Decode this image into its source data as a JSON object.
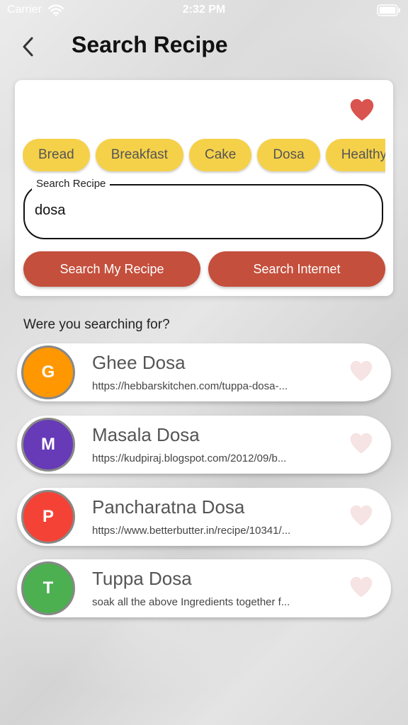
{
  "status_bar": {
    "carrier": "Carrier",
    "time": "2:32 PM"
  },
  "header": {
    "title": "Search Recipe",
    "back_icon": "chevron-left-icon"
  },
  "filter": {
    "favorite_icon": "heart-icon",
    "favorite_color": "#d9534f"
  },
  "categories": [
    "Bread",
    "Breakfast",
    "Cake",
    "Dosa",
    "Healthy"
  ],
  "search": {
    "label": "Search Recipe",
    "value": "dosa"
  },
  "buttons": {
    "search_my_recipe": "Search My Recipe",
    "search_internet": "Search Internet"
  },
  "colors": {
    "chip": "#f5d14a",
    "action_button": "#c44f3c",
    "unfavorited_heart": "#f6e3e3"
  },
  "suggestions": {
    "heading": "Were you searching for?",
    "items": [
      {
        "initial": "G",
        "title": "Ghee Dosa",
        "subtitle": "https://hebbarskitchen.com/tuppa-dosa-...",
        "avatar_color": "#ff9800"
      },
      {
        "initial": "M",
        "title": "Masala Dosa",
        "subtitle": "https://kudpiraj.blogspot.com/2012/09/b...",
        "avatar_color": "#673ab7"
      },
      {
        "initial": "P",
        "title": "Pancharatna Dosa",
        "subtitle": "https://www.betterbutter.in/recipe/10341/...",
        "avatar_color": "#f44336"
      },
      {
        "initial": "T",
        "title": "Tuppa Dosa",
        "subtitle": "soak all the above Ingredients together f...",
        "avatar_color": "#4caf50"
      }
    ]
  }
}
